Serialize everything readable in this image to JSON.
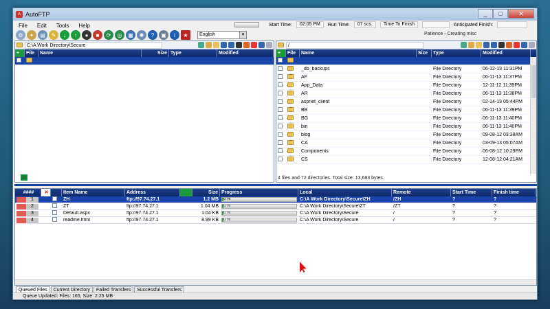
{
  "window": {
    "title": "AutoFTP",
    "min": "_",
    "max": "□",
    "close": "✕"
  },
  "menu": [
    "File",
    "Edit",
    "Tools",
    "Help"
  ],
  "toolbar": {
    "language": "English"
  },
  "timebar": {
    "start_label": "Start Time:",
    "start_value": "02:05 PM",
    "run_label": "Run Time:",
    "run_value": "07 scs.",
    "finish_label": "Time To Finish",
    "finish_value": "",
    "anticipated_label": "Anticipated Finish:",
    "anticipated_value": ""
  },
  "status_top": "Patience - Creating misc",
  "local": {
    "path": "C:\\A Work Directory\\Secure",
    "columns": [
      "File",
      "Name",
      "Size",
      "Type",
      "Modified"
    ],
    "rows": [
      {
        "name": "",
        "size": "",
        "type": "",
        "modified": ""
      }
    ]
  },
  "remote": {
    "path": "/",
    "columns": [
      "File",
      "Name",
      "Size",
      "Type",
      "Modified"
    ],
    "rows": [
      {
        "name": "",
        "type": "",
        "modified": ""
      },
      {
        "name": "_db_backups",
        "type": "File Directory",
        "modified": "06-12-13 11:31PM"
      },
      {
        "name": "AF",
        "type": "File Directory",
        "modified": "06-11-13 11:37PM"
      },
      {
        "name": "App_Data",
        "type": "File Directory",
        "modified": "12-11-12 11:39PM"
      },
      {
        "name": "AR",
        "type": "File Directory",
        "modified": "06-11-13 11:38PM"
      },
      {
        "name": "aspnet_client",
        "type": "File Directory",
        "modified": "02-14-13 05:44PM"
      },
      {
        "name": "BB",
        "type": "File Directory",
        "modified": "06-11-13 11:39PM"
      },
      {
        "name": "BG",
        "type": "File Directory",
        "modified": "06-11-13 11:40PM"
      },
      {
        "name": "bin",
        "type": "File Directory",
        "modified": "06-11-13 11:40PM"
      },
      {
        "name": "blog",
        "type": "File Directory",
        "modified": "09-08-12 03:38AM"
      },
      {
        "name": "CA",
        "type": "File Directory",
        "modified": "03-09-13 05:07AM"
      },
      {
        "name": "Components",
        "type": "File Directory",
        "modified": "06-08-12 10:29PM"
      },
      {
        "name": "CS",
        "type": "File Directory",
        "modified": "12-08-12 04:21AM"
      }
    ],
    "status": "4 files and 72 directories. Total size: 13,683 bytes."
  },
  "queue": {
    "columns": [
      "####",
      "",
      "",
      "Item Name",
      "Address",
      "",
      "Size",
      "Progress",
      "Local",
      "Remote",
      "Start Time",
      "Finish time"
    ],
    "rows": [
      {
        "num": "1",
        "name": "ZH",
        "address": "ftp://97.74.27.1",
        "size": "1.2 MB",
        "progress": 0,
        "progress_label": "0 %",
        "local": "C:\\A Work Directory\\Secure\\ZH",
        "remote": "/ZH",
        "start": "?",
        "finish": "?"
      },
      {
        "num": "2",
        "name": "ZT",
        "address": "ftp://97.74.27.1",
        "size": "1.04 MB",
        "progress": 0,
        "progress_label": "0 %",
        "local": "C:\\A Work Directory\\Secure\\ZT",
        "remote": "/ZT",
        "start": "?",
        "finish": "?"
      },
      {
        "num": "3",
        "name": "Default.aspx",
        "address": "ftp://97.74.27.1",
        "size": "1.04 KB",
        "progress": 0,
        "progress_label": "0 %",
        "local": "C:\\A Work Directory\\Secure",
        "remote": "/",
        "start": "?",
        "finish": "?"
      },
      {
        "num": "4",
        "name": "readme.html",
        "address": "ftp://97.74.27.1",
        "size": "8.99 KB",
        "progress": 0,
        "progress_label": "0 %",
        "local": "C:\\A Work Directory\\Secure",
        "remote": "/",
        "start": "?",
        "finish": "?"
      }
    ]
  },
  "tabs": [
    "Queued Files",
    "Current Directory",
    "Failed Transfers",
    "Successful Transfers"
  ],
  "statusbar": "Queue Updated: Files: 165, Size: 2.25 MB",
  "colors": {
    "header": "#0f2a6d",
    "selected": "#1b44a8",
    "accent_green": "#1c9c3b",
    "marker_red": "#e15a53"
  }
}
